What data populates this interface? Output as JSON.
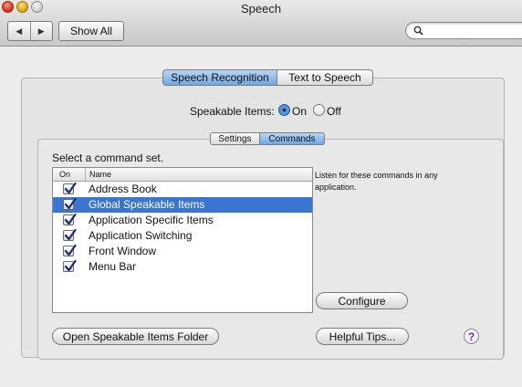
{
  "window": {
    "title": "Speech",
    "show_all_label": "Show All",
    "search_icon": "magnifier-icon"
  },
  "tabs": {
    "speech_recognition": "Speech Recognition",
    "text_to_speech": "Text to Speech",
    "selected": "Speech Recognition"
  },
  "speakable": {
    "label": "Speakable Items:",
    "on_label": "On",
    "off_label": "Off",
    "selected": "On"
  },
  "subtabs": {
    "settings": "Settings",
    "commands": "Commands",
    "selected": "Commands"
  },
  "commands": {
    "select_label": "Select a command set.",
    "columns": {
      "on": "On",
      "name": "Name"
    },
    "rows": [
      {
        "name": "Address Book",
        "checked": true
      },
      {
        "name": "Global Speakable Items",
        "checked": true
      },
      {
        "name": "Application Specific Items",
        "checked": true
      },
      {
        "name": "Application Switching",
        "checked": true
      },
      {
        "name": "Front Window",
        "checked": true
      },
      {
        "name": "Menu Bar",
        "checked": true
      }
    ],
    "selected_row": "Global Speakable Items",
    "description": "Listen for these commands in any application."
  },
  "buttons": {
    "configure": "Configure",
    "open_folder": "Open Speakable Items Folder",
    "helpful_tips": "Helpful Tips...",
    "help": "?"
  },
  "colors": {
    "selection": "#3a75d1",
    "accent": "#6fa6e3"
  }
}
